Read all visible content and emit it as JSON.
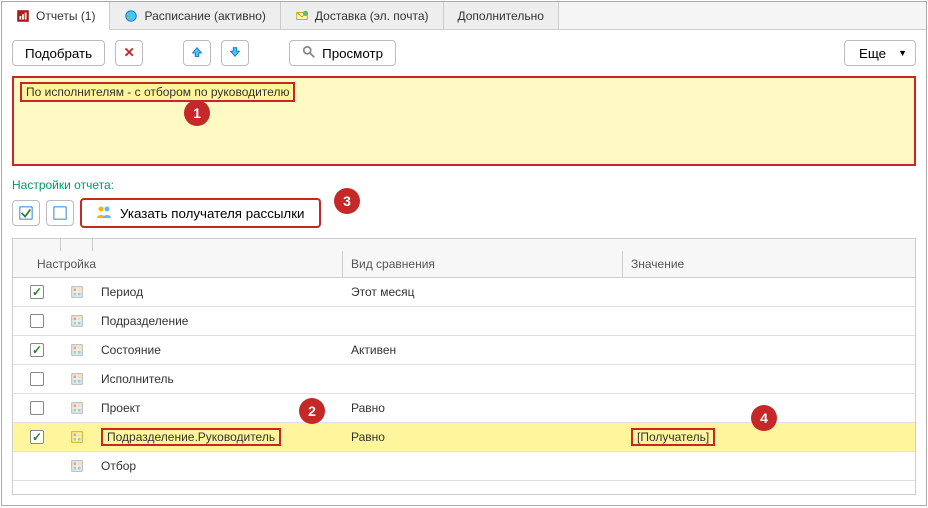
{
  "tabs": {
    "reports": "Отчеты (1)",
    "schedule": "Расписание (активно)",
    "delivery": "Доставка (эл. почта)",
    "additional": "Дополнительно"
  },
  "toolbar": {
    "select": "Подобрать",
    "preview": "Просмотр",
    "more": "Еще"
  },
  "panel": {
    "text": "По исполнителям - с отбором по руководителю"
  },
  "settings": {
    "label": "Настройки отчета:",
    "recipient_btn": "Указать получателя рассылки"
  },
  "grid": {
    "headers": {
      "setting": "Настройка",
      "comparison": "Вид сравнения",
      "value": "Значение"
    },
    "rows": [
      {
        "checked": true,
        "name": "Период",
        "comparison": "Этот месяц",
        "value": ""
      },
      {
        "checked": false,
        "name": "Подразделение",
        "comparison": "",
        "value": ""
      },
      {
        "checked": true,
        "name": "Состояние",
        "comparison": "Активен",
        "value": ""
      },
      {
        "checked": false,
        "name": "Исполнитель",
        "comparison": "",
        "value": ""
      },
      {
        "checked": false,
        "name": "Проект",
        "comparison": "Равно",
        "value": ""
      },
      {
        "checked": true,
        "name": "Подразделение.Руководитель",
        "comparison": "Равно",
        "value": "[Получатель]"
      },
      {
        "checked": false,
        "name": "Отбор",
        "comparison": "",
        "value": ""
      }
    ]
  },
  "callouts": {
    "one": "1",
    "two": "2",
    "three": "3",
    "four": "4"
  }
}
